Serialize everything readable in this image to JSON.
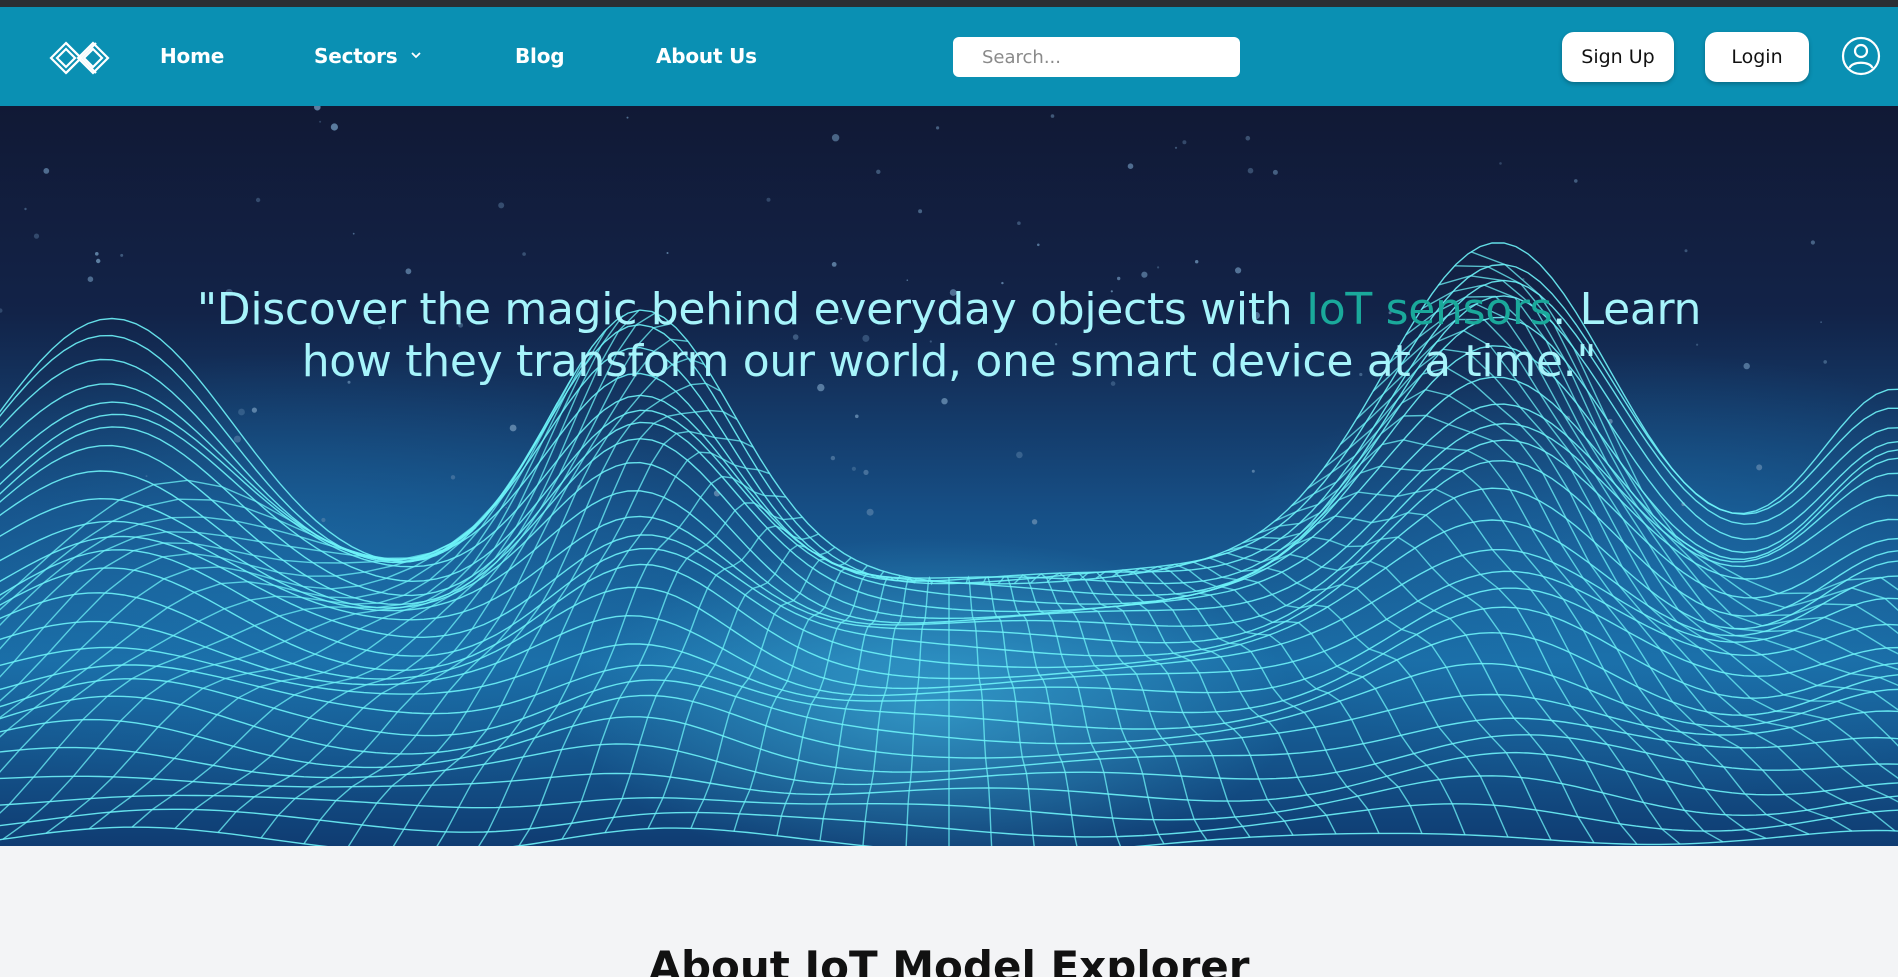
{
  "nav": {
    "logo_icon": "interlocked-diamonds-logo-icon",
    "links": [
      {
        "label": "Home"
      },
      {
        "label": "Sectors",
        "icon": "chevron-down-icon"
      },
      {
        "label": "Blog"
      },
      {
        "label": "About Us"
      }
    ],
    "search_placeholder": "Search...",
    "signup_label": "Sign Up",
    "login_label": "Login",
    "avatar_icon": "user-circle-icon",
    "bar_color": "#0a90b3"
  },
  "hero": {
    "quote_before": "\"Discover the magic behind everyday objects with ",
    "quote_highlight": "IoT sensors",
    "quote_after": ". Learn how they transform our world, one smart device at a time.\"",
    "quote_color": "#a6f4fb",
    "highlight_color": "#1aa99b",
    "background_art": "wireframe-mountains-starfield"
  },
  "about": {
    "title": "About IoT Model Explorer"
  }
}
